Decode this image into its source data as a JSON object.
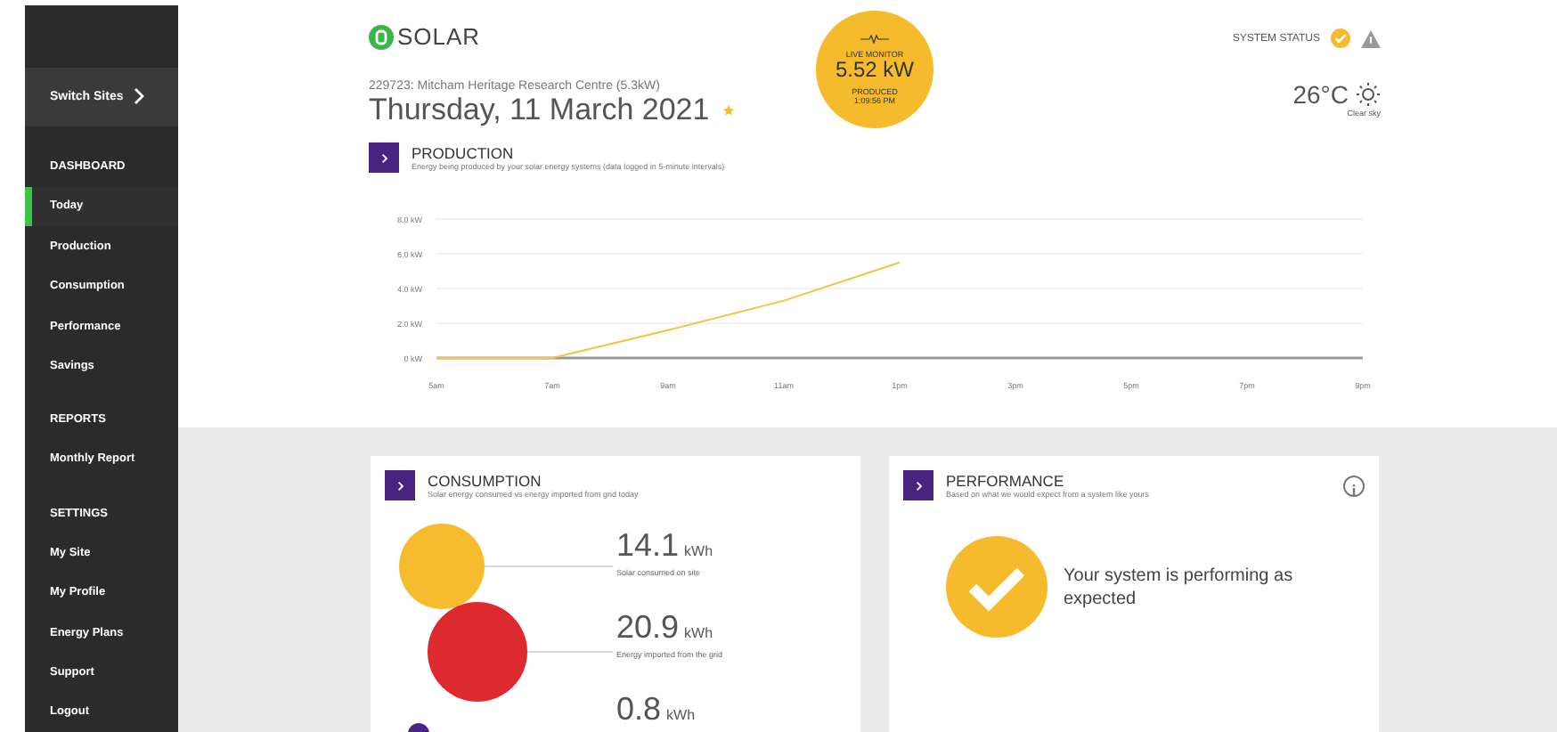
{
  "sidebar": {
    "switch_sites": "Switch Sites",
    "sections": [
      {
        "heading": "DASHBOARD",
        "items": [
          {
            "label": "Today",
            "selected": true
          },
          {
            "label": "Production",
            "selected": false
          },
          {
            "label": "Consumption",
            "selected": false
          },
          {
            "label": "Performance",
            "selected": false
          },
          {
            "label": "Savings",
            "selected": false
          }
        ]
      },
      {
        "heading": "REPORTS",
        "items": [
          {
            "label": "Monthly Report",
            "selected": false
          }
        ]
      },
      {
        "heading": "SETTINGS",
        "items": [
          {
            "label": "My Site",
            "selected": false
          },
          {
            "label": "My Profile",
            "selected": false
          },
          {
            "label": "Energy Plans",
            "selected": false
          },
          {
            "label": "Support",
            "selected": false
          },
          {
            "label": "Logout",
            "selected": false
          }
        ]
      }
    ]
  },
  "header": {
    "logo": "SOLAR",
    "site": "229723: Mitcham Heritage Research Centre (5.3kW)",
    "date": "Thursday, 11 March 2021",
    "live_monitor": {
      "label": "LIVE MONITOR",
      "value": "5.52 kW",
      "produced_label": "PRODUCED",
      "time": "1:09:56 PM"
    },
    "system_status": {
      "label": "SYSTEM STATUS",
      "ok": true,
      "warning": true
    },
    "weather": {
      "temperature": "26°C",
      "condition": "Clear sky"
    }
  },
  "production": {
    "title": "PRODUCTION",
    "subtitle": "Energy being produced by your solar energy systems (data logged in 5-minute intervals)",
    "chart_data": {
      "type": "line",
      "grid": true,
      "categories": [
        "5am",
        "7am",
        "9am",
        "11am",
        "1pm",
        "3pm",
        "5pm",
        "7pm",
        "9pm"
      ],
      "series": [
        {
          "color": "#f5c242",
          "values": [
            0,
            0,
            1.6,
            3.3,
            5.5,
            null,
            null,
            null,
            null
          ]
        }
      ],
      "ylim": [
        0,
        8
      ],
      "yticks": [
        {
          "value": 0,
          "label": "0 kW"
        },
        {
          "value": 2,
          "label": "2.0 kW"
        },
        {
          "value": 4,
          "label": "4.0 kW"
        },
        {
          "value": 6,
          "label": "6.0 kW"
        },
        {
          "value": 8,
          "label": "8.0 kW"
        }
      ]
    }
  },
  "consumption": {
    "title": "CONSUMPTION",
    "subtitle": "Solar energy consumed vs energy imported from grid today",
    "items": [
      {
        "value": "14.1",
        "unit": "kWh",
        "label": "Solar consumed on site",
        "color": "#f7bb2e"
      },
      {
        "value": "20.9",
        "unit": "kWh",
        "label": "Energy imported from the grid",
        "color": "#dc2a2e"
      },
      {
        "value": "0.8",
        "unit": "kWh",
        "color": "#4b2386"
      }
    ]
  },
  "performance": {
    "title": "PERFORMANCE",
    "subtitle": "Based on what we would expect from a system like yours",
    "message": "Your system is performing as expected"
  }
}
